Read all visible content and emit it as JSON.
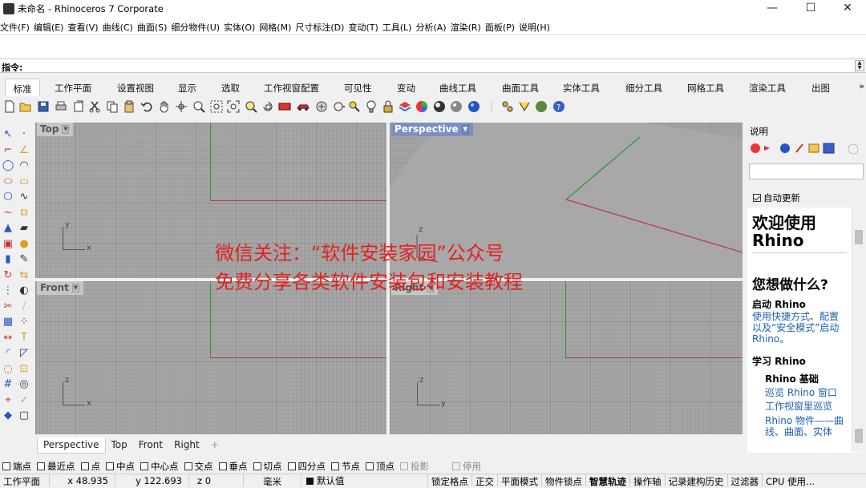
{
  "window": {
    "title": "未命名 - Rhinoceros 7 Corporate",
    "minimize": "—",
    "maximize": "☐",
    "close": "✕"
  },
  "menu": [
    "文件(F)",
    "编辑(E)",
    "查看(V)",
    "曲线(C)",
    "曲面(S)",
    "细分物件(U)",
    "实体(O)",
    "网格(M)",
    "尺寸标注(D)",
    "变动(T)",
    "工具(L)",
    "分析(A)",
    "渲染(R)",
    "面板(P)",
    "说明(H)"
  ],
  "command": {
    "label": "指令:",
    "value": ""
  },
  "tabs": {
    "items": [
      "标准",
      "工作平面",
      "设置视图",
      "显示",
      "选取",
      "工作视窗配置",
      "可见性",
      "变动",
      "曲线工具",
      "曲面工具",
      "实体工具",
      "细分工具",
      "网格工具",
      "渲染工具",
      "出图"
    ],
    "active": "标准",
    "more": "»"
  },
  "viewports": {
    "top": {
      "label": "Top"
    },
    "perspective": {
      "label": "Perspective"
    },
    "front": {
      "label": "Front"
    },
    "right": {
      "label": "Right"
    },
    "axis_labels": {
      "x": "x",
      "y": "y",
      "z": "z"
    }
  },
  "watermark": {
    "line1": "微信关注：“软件安装家园”公众号",
    "line2": "免费分享各类软件安装包和安装教程"
  },
  "viewport_tabs": [
    "Perspective",
    "Top",
    "Front",
    "Right"
  ],
  "viewport_tabs_add": "+",
  "osnap": [
    {
      "label": "端点",
      "enabled": true
    },
    {
      "label": "最近点",
      "enabled": true
    },
    {
      "label": "点",
      "enabled": true
    },
    {
      "label": "中点",
      "enabled": true
    },
    {
      "label": "中心点",
      "enabled": true
    },
    {
      "label": "交点",
      "enabled": true
    },
    {
      "label": "垂点",
      "enabled": true
    },
    {
      "label": "切点",
      "enabled": true
    },
    {
      "label": "四分点",
      "enabled": true
    },
    {
      "label": "节点",
      "enabled": true
    },
    {
      "label": "顶点",
      "enabled": true
    },
    {
      "label": "投影",
      "enabled": false
    },
    {
      "label": "停用",
      "enabled": false
    }
  ],
  "status": {
    "cplane": "工作平面",
    "x": "x 48.935",
    "y": "y 122.693",
    "z": "z 0",
    "unit": "毫米",
    "layer": "默认值",
    "buttons": [
      "锁定格点",
      "正交",
      "平面模式",
      "物件锁点",
      "智慧轨迹",
      "操作轴",
      "记录建构历史",
      "过滤器",
      "CPU 使用..."
    ],
    "bold_button": "智慧轨迹"
  },
  "panel": {
    "title": "说明",
    "auto_update": "自动更新",
    "welcome": "欢迎使用 Rhino",
    "question": "您想做什么?",
    "section1": "启动 Rhino",
    "section1_link": "使用快捷方式、配置以及“安全模式”启动 Rhino。",
    "section2": "学习 Rhino",
    "subsection": "Rhino 基础",
    "links": [
      "巡览 Rhino 窗口",
      "工作视窗里巡览",
      "Rhino 物件——曲线、曲面、实体"
    ]
  },
  "colors": {
    "x_axis": "#b63838",
    "y_axis": "#2a9a2a",
    "active_viewport_label": "#7c8fc0",
    "link": "#1a5fb4",
    "watermark": "#e32020"
  }
}
